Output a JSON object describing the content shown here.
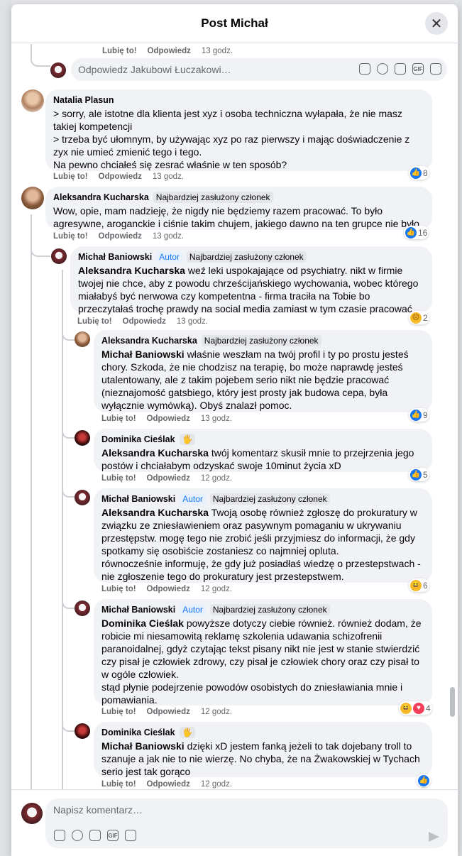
{
  "header": {
    "title": "Post Michał",
    "close": "✕"
  },
  "meta_labels": {
    "like": "Lubię to!",
    "reply": "Odpowiedz"
  },
  "top_meta": {
    "time": "13 godz."
  },
  "reply_box": {
    "placeholder": "Odpowiedz Jakubowi Łuczakowi…"
  },
  "comments": [
    {
      "author": "Natalia Plasun",
      "lines": [
        "> sorry, ale istotne dla klienta jest xyz i osoba techniczna wyłapała, że nie masz takiej kompetencji",
        "> trzeba być ułomnym, by używając xyz po raz pierwszy i mając doświadczenie z zyx nie umieć zmienić tego i tego.",
        "Na pewno chciałeś się zesrać właśnie w ten sposób?"
      ],
      "time": "13 godz.",
      "reactions": "8"
    },
    {
      "author": "Aleksandra Kucharska",
      "badge": "Najbardziej zasłużony członek",
      "text": "Wow, opie, mam nadzieję, że nigdy nie będziemy razem pracować. To było agresywne, aroganckie i ciśnie takim chujem, jakiego dawno na ten grupce nie było.",
      "time": "13 godz.",
      "reactions": "16"
    },
    {
      "author": "Michał Baniowski",
      "author_tag": "Autor",
      "badge": "Najbardziej zasłużony członek",
      "mention": "Aleksandra Kucharska",
      "text": " weź leki uspokajające od psychiatry. nikt w firmie twojej nie chce, aby z powodu chrześcijańskiego wychowania, wobec którego miałabyś być nerwowa czy kompetentna - firma traciła na Tobie bo przeczytałaś trochę prawdy na social media zamiast w tym czasie pracować.",
      "time": "13 godz.",
      "reactions": "2"
    },
    {
      "author": "Aleksandra Kucharska",
      "badge": "Najbardziej zasłużony członek",
      "mention": "Michał Baniowski",
      "text": " właśnie weszłam na twój profil i ty po prostu jesteś chory. Szkoda, że nie chodzisz na terapię, bo może naprawdę jesteś utalentowany, ale z takim pojebem serio nikt nie będzie pracować (nieznajomość gatsbiego, który jest prosty jak budowa cepa, była wyłącznie wymówką). Obyś znalazł pomoc.",
      "time": "13 godz.",
      "reactions": "9"
    },
    {
      "author": "Dominika Cieślak",
      "mention": "Aleksandra Kucharska",
      "text": " twój komentarz skusił mnie to przejrzenia jego postów i chciałabym odzyskać swoje 10minut życia xD",
      "time": "12 godz.",
      "reactions": "5"
    },
    {
      "author": "Michał Baniowski",
      "author_tag": "Autor",
      "badge": "Najbardziej zasłużony członek",
      "mention": "Aleksandra Kucharska",
      "text": " Twoją osobę również zgłoszę do prokuratury w związku ze zniesławieniem oraz pasywnym pomaganiu w ukrywaniu przestępstw. mogę tego nie zrobić jeśli przyjmiesz do informacji, że gdy spotkamy się osobiście zostaniesz co najmniej opluta.\nrównocześnie informuję, że gdy już posiadłaś wiedzę o przestepstwach - nie zgłoszenie tego do prokuratury jest przestepstwem.",
      "time": "12 godz.",
      "reactions": "6"
    },
    {
      "author": "Michał Baniowski",
      "author_tag": "Autor",
      "badge": "Najbardziej zasłużony członek",
      "mention": "Dominika Cieślak",
      "text": " powyższe dotyczy ciebie również. również dodam, że robicie mi niesamowitą reklamę szkolenia udawania schizofrenii paranoidalnej, gdyż czytając tekst pisany nikt nie jest w stanie stwierdzić czy pisał je człowiek zdrowy, czy pisał je człowiek chory oraz czy pisał to w ogóle człowiek.\nstąd płynie podejrzenie powodów osobistych do zniesławiania mnie i pomawiania.",
      "time": "12 godz.",
      "reactions": "4"
    },
    {
      "author": "Dominika Cieślak",
      "mention": "Michał Baniowski",
      "text": " dzięki xD jestem fanką jeżeli to tak dojebany troll to szanuje a jak nie to nie wierzę. No chyba, że na Żwakowskiej w Tychach serio jest tak gorąco",
      "time": "12 godz.",
      "reactions": ""
    }
  ],
  "composer": {
    "placeholder": "Napisz komentarz…"
  },
  "icons": {
    "gif": "GIF"
  }
}
